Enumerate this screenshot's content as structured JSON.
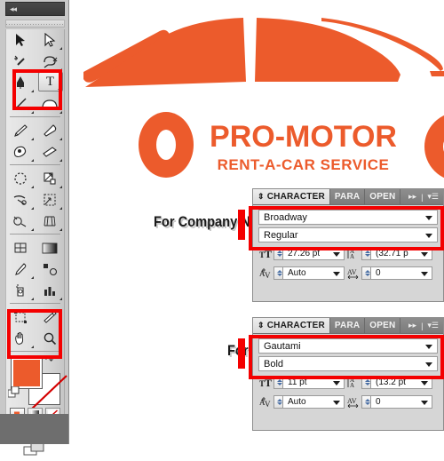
{
  "artwork": {
    "logo_name": "PRO-MOTOR",
    "logo_tagline": "RENT-A-CAR SERVICE",
    "brand_orange": "#ec5b2c",
    "car_icon": "car-silhouette-icon",
    "ring_left_icon": "orange-ring-left",
    "ring_right_icon": "orange-ring-right"
  },
  "annotations": {
    "company_name_label": "For Company Name",
    "tag_line_label": "For Tag Line",
    "highlight_color": "#f40000"
  },
  "toolpanel": {
    "collapse_icon": "double-arrow-left-icon",
    "grip_icon": "panel-grip-icon",
    "tools": [
      {
        "name": "selection-tool",
        "icon": "arrow-cursor-icon"
      },
      {
        "name": "direct-selection-tool",
        "icon": "white-arrow-cursor-icon"
      },
      {
        "name": "magic-wand-tool",
        "icon": "magic-wand-icon"
      },
      {
        "name": "lasso-tool",
        "icon": "lasso-icon"
      },
      {
        "name": "pen-tool",
        "icon": "pen-nib-icon"
      },
      {
        "name": "type-tool",
        "icon": "type-t-icon",
        "selected": true
      },
      {
        "name": "line-segment-tool",
        "icon": "line-segment-icon"
      },
      {
        "name": "shape-tool",
        "icon": "rectangle-shape-icon"
      },
      {
        "name": "paintbrush-tool",
        "icon": "paintbrush-icon"
      },
      {
        "name": "pencil-tool",
        "icon": "pencil-icon"
      },
      {
        "name": "blob-brush-tool",
        "icon": "blob-brush-icon"
      },
      {
        "name": "eraser-tool",
        "icon": "eraser-icon"
      },
      {
        "name": "rotate-tool",
        "icon": "rotate-icon"
      },
      {
        "name": "scale-tool",
        "icon": "scale-icon"
      },
      {
        "name": "width-tool",
        "icon": "width-scissors-icon"
      },
      {
        "name": "free-transform-tool",
        "icon": "free-transform-icon"
      },
      {
        "name": "shape-builder-tool",
        "icon": "shape-builder-icon"
      },
      {
        "name": "perspective-grid-tool",
        "icon": "perspective-grid-icon"
      },
      {
        "name": "mesh-tool",
        "icon": "mesh-icon"
      },
      {
        "name": "gradient-tool",
        "icon": "gradient-icon"
      },
      {
        "name": "eyedropper-tool",
        "icon": "eyedropper-icon"
      },
      {
        "name": "blend-tool",
        "icon": "blend-icon"
      },
      {
        "name": "symbol-sprayer-tool",
        "icon": "symbol-sprayer-icon"
      },
      {
        "name": "column-graph-tool",
        "icon": "bar-graph-icon"
      },
      {
        "name": "artboard-tool",
        "icon": "artboard-icon"
      },
      {
        "name": "slice-tool",
        "icon": "slice-knife-icon"
      },
      {
        "name": "hand-tool",
        "icon": "hand-icon"
      },
      {
        "name": "zoom-tool",
        "icon": "magnifier-icon"
      }
    ],
    "fill_swatch_color": "#ec5b2c",
    "stroke_swatch_color": "#ffffff",
    "swap_icon": "swap-fill-stroke-icon",
    "default_icon": "default-fill-stroke-icon",
    "fill_modes": [
      {
        "name": "color-mode-button",
        "icon": "solid-color-icon",
        "active": true
      },
      {
        "name": "gradient-mode-button",
        "icon": "gradient-swatch-icon",
        "active": false
      },
      {
        "name": "none-mode-button",
        "icon": "none-slash-icon",
        "active": false
      }
    ],
    "draw_modes": [
      {
        "name": "draw-normal-button",
        "icon": "draw-normal-icon",
        "active": true
      },
      {
        "name": "draw-behind-button",
        "icon": "draw-behind-icon",
        "active": false
      },
      {
        "name": "draw-inside-button",
        "icon": "draw-inside-icon",
        "active": false
      }
    ],
    "screen_mode": {
      "name": "screen-mode-button",
      "icon": "screen-mode-icon"
    }
  },
  "character_panels": [
    {
      "tabs": [
        {
          "label": "CHARACTER",
          "active": true
        },
        {
          "label": "PARA",
          "active": false
        },
        {
          "label": "OPEN",
          "active": false
        }
      ],
      "expand_icon": "double-chevron-right-icon",
      "menu_icon": "panel-menu-icon",
      "font_family": "Broadway",
      "font_style": "Regular",
      "font_size": "27.26 pt",
      "leading": "(32.71 p",
      "kerning": "Auto",
      "tracking": "0",
      "size_icon": "font-size-icon",
      "leading_icon": "leading-icon",
      "kerning_icon": "kerning-icon",
      "tracking_icon": "tracking-icon"
    },
    {
      "tabs": [
        {
          "label": "CHARACTER",
          "active": true
        },
        {
          "label": "PARA",
          "active": false
        },
        {
          "label": "OPEN",
          "active": false
        }
      ],
      "expand_icon": "double-chevron-right-icon",
      "menu_icon": "panel-menu-icon",
      "font_family": "Gautami",
      "font_style": "Bold",
      "font_size": "11 pt",
      "leading": "(13.2 pt",
      "kerning": "Auto",
      "tracking": "0",
      "size_icon": "font-size-icon",
      "leading_icon": "leading-icon",
      "kerning_icon": "kerning-icon",
      "tracking_icon": "tracking-icon"
    }
  ]
}
